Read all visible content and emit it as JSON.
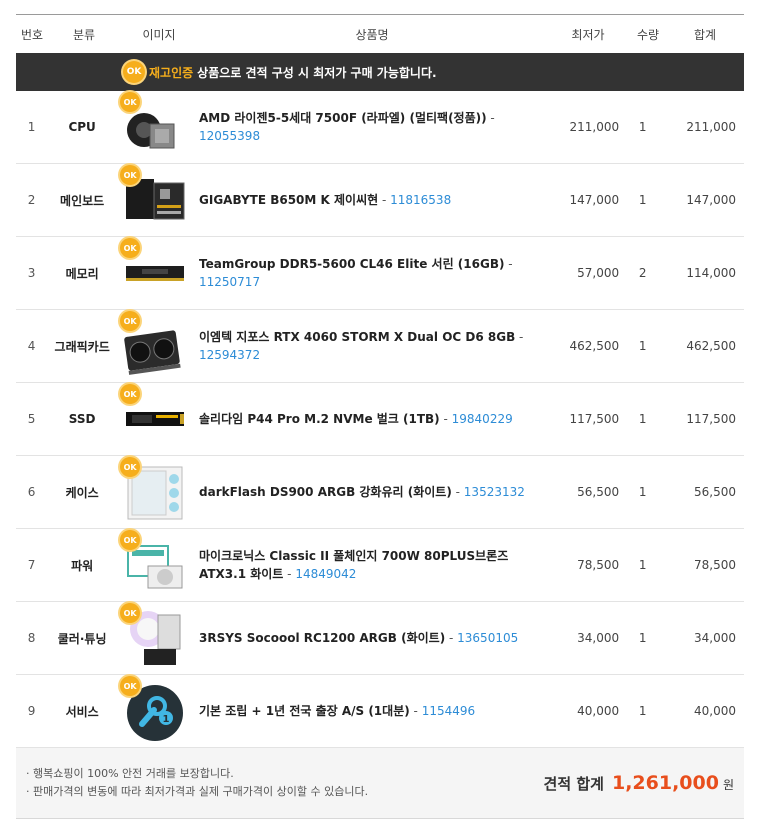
{
  "header": {
    "no": "번호",
    "category": "분류",
    "image": "이미지",
    "name": "상품명",
    "lowest_price": "최저가",
    "quantity": "수량",
    "sum": "합계"
  },
  "banner": {
    "badge": "OK",
    "highlight": "재고인증",
    "text": "상품으로 견적 구성 시 최저가 구매 가능합니다."
  },
  "rows": [
    {
      "no": "1",
      "category": "CPU",
      "badge": "OK",
      "name": "AMD 라이젠5-5세대 7500F (라파엘) (멀티팩(정품))",
      "dash": " - ",
      "code": "12055398",
      "price": "211,000",
      "qty": "1",
      "sum": "211,000",
      "icon": "cpu-product-icon"
    },
    {
      "no": "2",
      "category": "메인보드",
      "badge": "OK",
      "name": "GIGABYTE B650M K 제이씨현",
      "dash": " - ",
      "code": "11816538",
      "price": "147,000",
      "qty": "1",
      "sum": "147,000",
      "icon": "motherboard-product-icon"
    },
    {
      "no": "3",
      "category": "메모리",
      "badge": "OK",
      "name": "TeamGroup DDR5-5600 CL46 Elite 서린 (16GB)",
      "dash": " - ",
      "code": "11250717",
      "price": "57,000",
      "qty": "2",
      "sum": "114,000",
      "icon": "memory-product-icon"
    },
    {
      "no": "4",
      "category": "그래픽카드",
      "badge": "OK",
      "name": "이엠텍 지포스 RTX 4060 STORM X Dual OC D6 8GB",
      "dash": " - ",
      "code": "12594372",
      "price": "462,500",
      "qty": "1",
      "sum": "462,500",
      "icon": "graphics-card-product-icon"
    },
    {
      "no": "5",
      "category": "SSD",
      "badge": "OK",
      "name": "솔리다임 P44 Pro M.2 NVMe 벌크 (1TB)",
      "dash": " - ",
      "code": "19840229",
      "price": "117,500",
      "qty": "1",
      "sum": "117,500",
      "icon": "ssd-product-icon"
    },
    {
      "no": "6",
      "category": "케이스",
      "badge": "OK",
      "name": "darkFlash DS900 ARGB 강화유리 (화이트)",
      "dash": " - ",
      "code": "13523132",
      "price": "56,500",
      "qty": "1",
      "sum": "56,500",
      "icon": "case-product-icon"
    },
    {
      "no": "7",
      "category": "파워",
      "badge": "OK",
      "name": "마이크로닉스 Classic II 풀체인지 700W 80PLUS브론즈 ATX3.1 화이트",
      "dash": " - ",
      "code": "14849042",
      "price": "78,500",
      "qty": "1",
      "sum": "78,500",
      "icon": "power-supply-product-icon"
    },
    {
      "no": "8",
      "category": "쿨러·튜닝",
      "badge": "OK",
      "name": "3RSYS Socoool RC1200 ARGB (화이트)",
      "dash": " - ",
      "code": "13650105",
      "price": "34,000",
      "qty": "1",
      "sum": "34,000",
      "icon": "cooler-product-icon"
    },
    {
      "no": "9",
      "category": "서비스",
      "badge": "OK",
      "name": "기본 조립 + 1년 전국 출장 A/S (1대분)",
      "dash": " - ",
      "code": "1154496",
      "price": "40,000",
      "qty": "1",
      "sum": "40,000",
      "icon": "service-wrench-icon"
    }
  ],
  "footer": {
    "notes": [
      "· 행복쇼핑이 100% 안전 거래를 보장합니다.",
      "· 판매가격의 변동에 따라 최저가격과 실제 구매가격이 상이할 수 있습니다."
    ],
    "total_label": "견적 합계",
    "total_value": "1,261,000",
    "total_unit": "원"
  },
  "colors": {
    "banner_bg": "#333333",
    "ok_badge": "#f6ae1c",
    "link": "#2d8cd6",
    "total": "#e84e1c"
  }
}
